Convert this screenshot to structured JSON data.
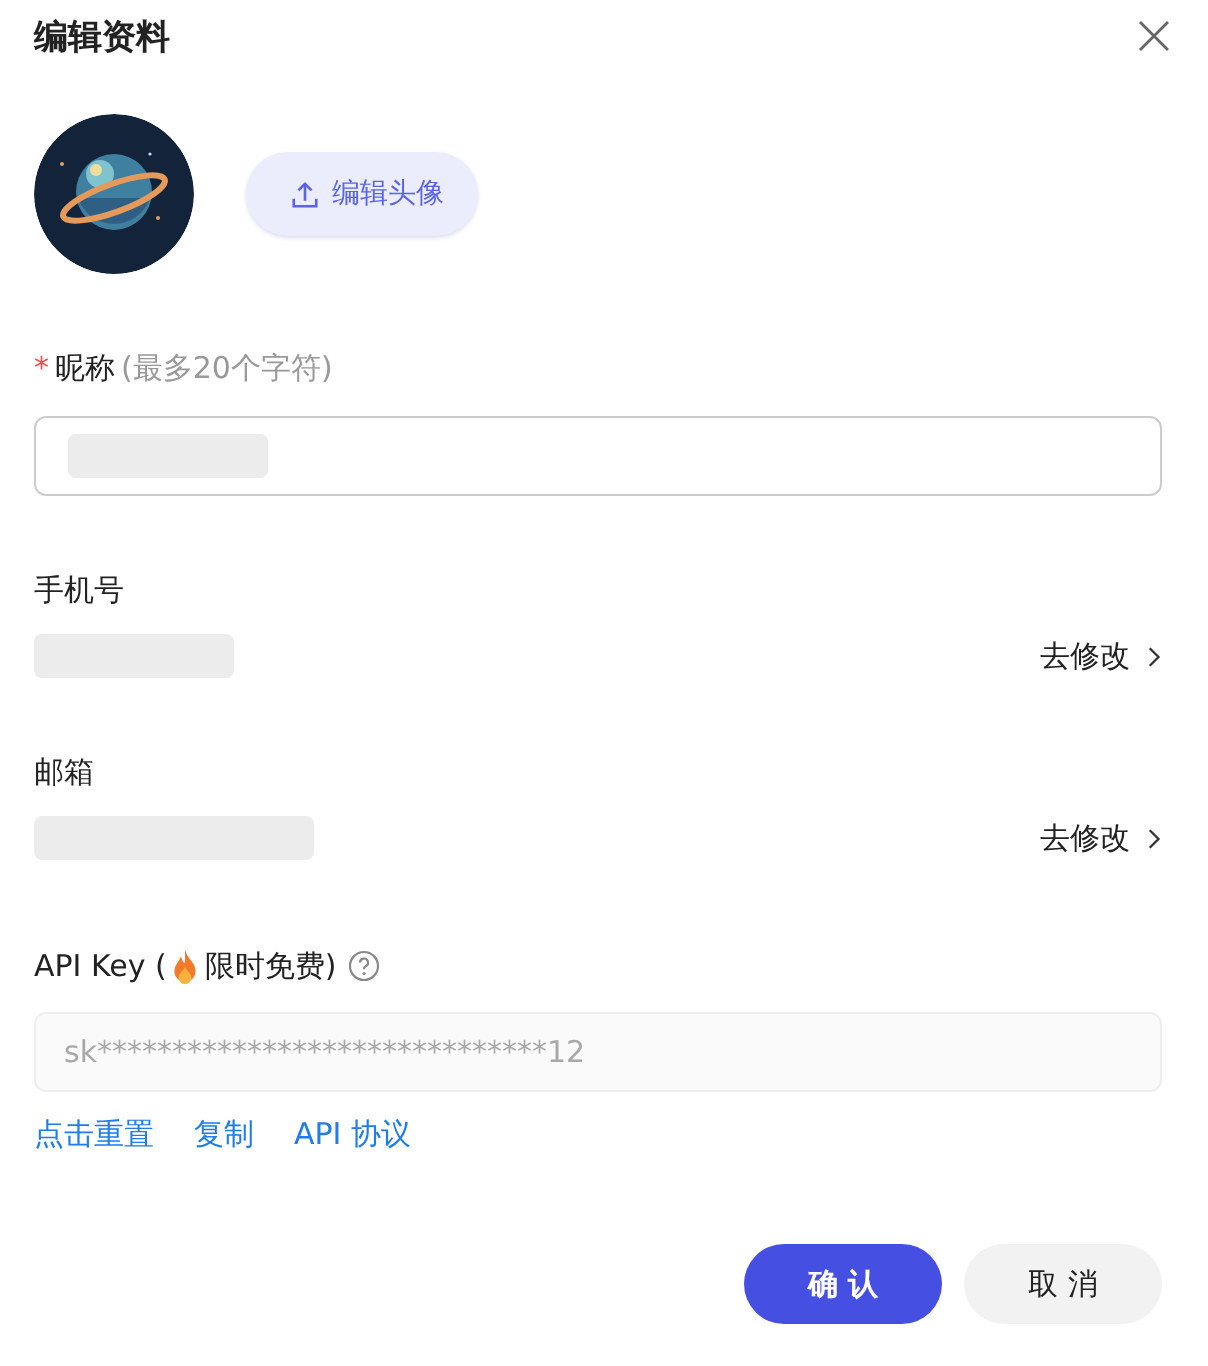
{
  "dialog": {
    "title": "编辑资料"
  },
  "avatar": {
    "kind": "picture",
    "button": "编辑头像"
  },
  "nickname": {
    "required": true,
    "required_mark": "*",
    "label": "昵称",
    "hint": "(最多20个字符)",
    "redacted": true
  },
  "contacts": [
    {
      "label": "手机号",
      "redacted": true,
      "action": "去修改"
    },
    {
      "label": "邮箱",
      "redacted": true,
      "action": "去修改"
    }
  ],
  "api_key": {
    "label_prefix": "API Key (",
    "label_suffix": "限时免费)",
    "value": "sk******************************12",
    "disabled": true,
    "links": [
      "点击重置",
      "复制",
      "API 协议"
    ]
  },
  "buttons": [
    {
      "label": "确 认",
      "kind": "primary"
    },
    {
      "label": "取 消",
      "kind": "secondary"
    }
  ]
}
